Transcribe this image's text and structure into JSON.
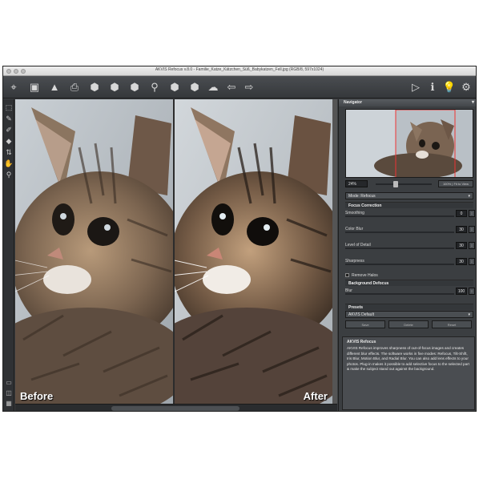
{
  "window": {
    "title": "AKVIS Refocus v.8.0 - Familie_Katze_Kätzchen_Süß_Babykatzen_Fell.jpg (RGB/8, 597x1024)"
  },
  "toolbar": {
    "icons": [
      "cursor-icon",
      "open-icon",
      "save-icon",
      "print-icon",
      "batch-icon",
      "share-icon",
      "settings-icon",
      "preset-icon",
      "share-link-icon",
      "undo-icon",
      "redo-icon",
      "back-icon",
      "forward-icon",
      "run-icon",
      "info-icon",
      "hint-icon",
      "preferences-icon"
    ]
  },
  "tools": [
    "crop-icon",
    "brush-icon",
    "eraser-icon",
    "bucket-icon",
    "swap-icon",
    "hand-icon",
    "zoom-icon"
  ],
  "canvas": {
    "before_label": "Before",
    "after_label": "After"
  },
  "navigator": {
    "header": "Navigator",
    "zoom_value": "24%",
    "fit_label": "100% | Fit to View"
  },
  "panel": {
    "mode_label": "Mode",
    "mode_value": "Refocus",
    "focus_header": "Focus Correction",
    "params": [
      {
        "label": "Smoothing",
        "value": "0"
      },
      {
        "label": "Color Blur",
        "value": "30"
      },
      {
        "label": "Level of Detail",
        "value": "30"
      },
      {
        "label": "Sharpness",
        "value": "30"
      }
    ],
    "remove_halos_label": "Remove Halos",
    "bg_header": "Background Defocus",
    "blur_label": "Blur",
    "blur_value": "100",
    "presets_label": "Presets",
    "preset_value": "AKVIS Default",
    "preset_buttons": [
      "Save",
      "Delete",
      "Reset"
    ],
    "help_title": "AKVIS Refocus",
    "help_text": "AKVIS Refocus improves sharpness of out-of-focus images and creates different blur effects. The software works in five modes: Refocus, Tilt-Shift, Iris Blur, Motion Blur, and Radial Blur. You can also add lens effects to your photos. Plug-in makes it possible to add selective focus to the selected part & make the subject stand out against the background."
  }
}
